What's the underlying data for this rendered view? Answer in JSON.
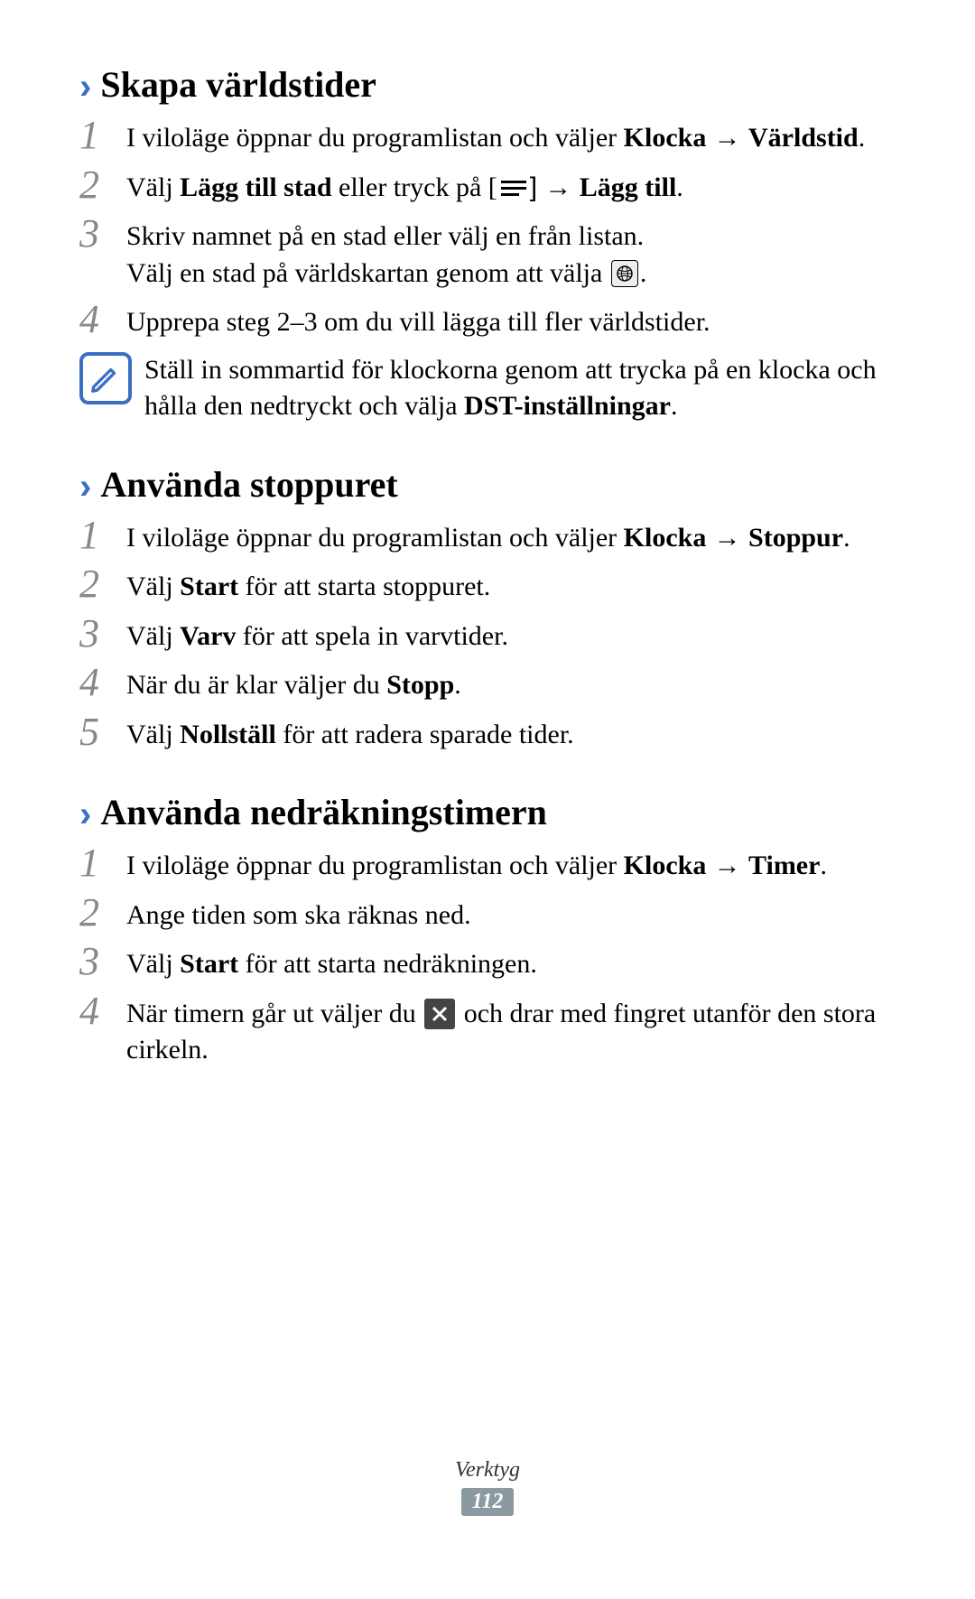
{
  "section1": {
    "heading": "Skapa världstider",
    "step1": {
      "t1": "I viloläge öppnar du programlistan och väljer ",
      "b1": "Klocka",
      "t2": " → ",
      "b2": "Världstid",
      "t3": "."
    },
    "step2": {
      "t1": "Välj ",
      "b1": "Lägg till stad",
      "t2": " eller tryck på [",
      "t3": "] → ",
      "b2": "Lägg till",
      "t4": "."
    },
    "step3": {
      "line1": "Skriv namnet på en stad eller välj en från listan.",
      "line2a": "Välj en stad på världskartan genom att välja ",
      "line2b": "."
    },
    "step4": "Upprepa steg 2–3 om du vill lägga till fler världstider.",
    "note": {
      "t1": "Ställ in sommartid för klockorna genom att trycka på en klocka och hålla den nedtryckt och välja ",
      "b1": "DST-inställningar",
      "t2": "."
    }
  },
  "section2": {
    "heading": "Använda stoppuret",
    "step1": {
      "t1": "I viloläge öppnar du programlistan och väljer ",
      "b1": "Klocka",
      "t2": " → ",
      "b2": "Stoppur",
      "t3": "."
    },
    "step2": {
      "t1": "Välj ",
      "b1": "Start",
      "t2": " för att starta stoppuret."
    },
    "step3": {
      "t1": "Välj ",
      "b1": "Varv",
      "t2": " för att spela in varvtider."
    },
    "step4": {
      "t1": "När du är klar väljer du ",
      "b1": "Stopp",
      "t2": "."
    },
    "step5": {
      "t1": "Välj ",
      "b1": "Nollställ",
      "t2": " för att radera sparade tider."
    }
  },
  "section3": {
    "heading": "Använda nedräkningstimern",
    "step1": {
      "t1": "I viloläge öppnar du programlistan och väljer ",
      "b1": "Klocka",
      "t2": " → ",
      "b2": "Timer",
      "t3": "."
    },
    "step2": "Ange tiden som ska räknas ned.",
    "step3": {
      "t1": "Välj ",
      "b1": "Start",
      "t2": " för att starta nedräkningen."
    },
    "step4": {
      "t1": "När timern går ut väljer du ",
      "t2": " och drar med fingret utanför den stora cirkeln."
    }
  },
  "numbers": {
    "n1": "1",
    "n2": "2",
    "n3": "3",
    "n4": "4",
    "n5": "5"
  },
  "footer": {
    "label": "Verktyg",
    "page": "112"
  }
}
